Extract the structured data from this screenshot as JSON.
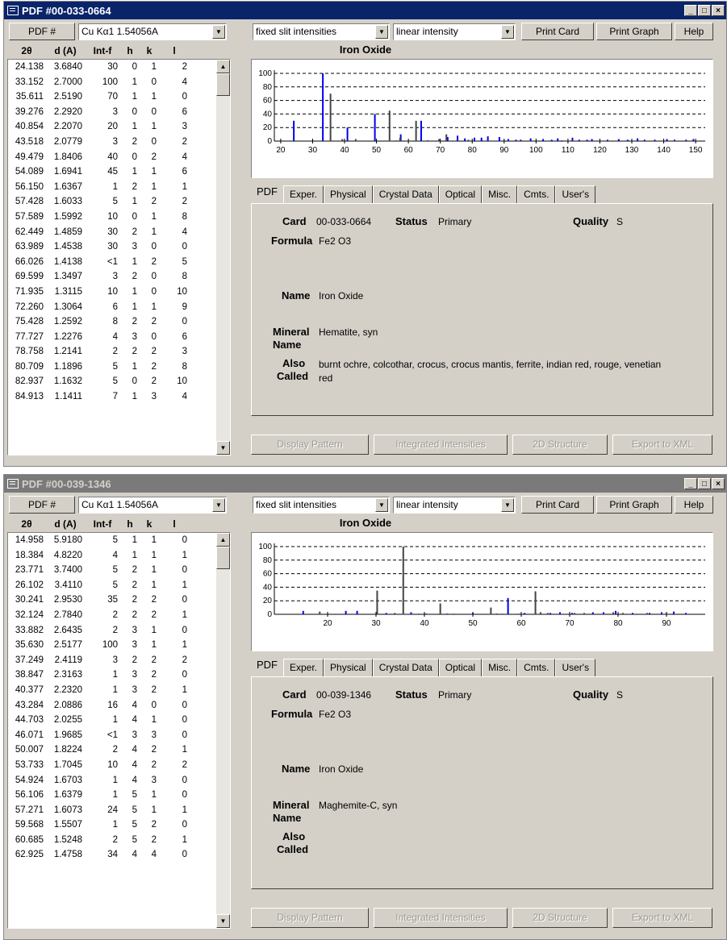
{
  "windows": [
    {
      "title": "PDF #00-033-0664",
      "active": true,
      "top_offset": 1,
      "pdf_button": "PDF #",
      "radiation": "Cu Kα1 1.54056A",
      "intensity_mode": "fixed slit intensities",
      "intensity_scale": "linear intensity",
      "print_card": "Print Card",
      "print_graph": "Print Graph",
      "help": "Help",
      "columns": [
        "2θ",
        "d (A)",
        "Int-f",
        "h",
        "k",
        "l"
      ],
      "rows": [
        [
          "24.138",
          "3.6840",
          "30",
          "0",
          "1",
          "2"
        ],
        [
          "33.152",
          "2.7000",
          "100",
          "1",
          "0",
          "4"
        ],
        [
          "35.611",
          "2.5190",
          "70",
          "1",
          "1",
          "0"
        ],
        [
          "39.276",
          "2.2920",
          "3",
          "0",
          "0",
          "6"
        ],
        [
          "40.854",
          "2.2070",
          "20",
          "1",
          "1",
          "3"
        ],
        [
          "43.518",
          "2.0779",
          "3",
          "2",
          "0",
          "2"
        ],
        [
          "49.479",
          "1.8406",
          "40",
          "0",
          "2",
          "4"
        ],
        [
          "54.089",
          "1.6941",
          "45",
          "1",
          "1",
          "6"
        ],
        [
          "56.150",
          "1.6367",
          "1",
          "2",
          "1",
          "1"
        ],
        [
          "57.428",
          "1.6033",
          "5",
          "1",
          "2",
          "2"
        ],
        [
          "57.589",
          "1.5992",
          "10",
          "0",
          "1",
          "8"
        ],
        [
          "62.449",
          "1.4859",
          "30",
          "2",
          "1",
          "4"
        ],
        [
          "63.989",
          "1.4538",
          "30",
          "3",
          "0",
          "0"
        ],
        [
          "66.026",
          "1.4138",
          "<1",
          "1",
          "2",
          "5"
        ],
        [
          "69.599",
          "1.3497",
          "3",
          "2",
          "0",
          "8"
        ],
        [
          "71.935",
          "1.3115",
          "10",
          "1",
          "0",
          "10"
        ],
        [
          "72.260",
          "1.3064",
          "6",
          "1",
          "1",
          "9"
        ],
        [
          "75.428",
          "1.2592",
          "8",
          "2",
          "2",
          "0"
        ],
        [
          "77.727",
          "1.2276",
          "4",
          "3",
          "0",
          "6"
        ],
        [
          "78.758",
          "1.2141",
          "2",
          "2",
          "2",
          "3"
        ],
        [
          "80.709",
          "1.1896",
          "5",
          "1",
          "2",
          "8"
        ],
        [
          "82.937",
          "1.1632",
          "5",
          "0",
          "2",
          "10"
        ],
        [
          "84.913",
          "1.1411",
          "7",
          "1",
          "3",
          "4"
        ]
      ],
      "chart_title": "Iron Oxide",
      "chart_data": {
        "type": "bar",
        "xlim": [
          18,
          153
        ],
        "ylim": [
          0,
          100
        ],
        "xticks": [
          20,
          30,
          40,
          50,
          60,
          70,
          80,
          90,
          100,
          110,
          120,
          130,
          140,
          150
        ],
        "yticks": [
          0,
          20,
          40,
          60,
          80,
          100
        ],
        "grid": "dashed horizontal",
        "series": [
          {
            "color": "#0000ee",
            "x": [
              24.1,
              33.2,
              40.9,
              49.5,
              57.6,
              64.0,
              66.0,
              72.3,
              75.4,
              77.7,
              80.7,
              82.9,
              84.9,
              88.5,
              91.3,
              93.7,
              95.2,
              98.3,
              102.2,
              104.9,
              106.8,
              108.1,
              111.4,
              113.5,
              116.0,
              117.5,
              122.4,
              125.9,
              128.7,
              131.8,
              134.0,
              137.2,
              141.0,
              143.4,
              147.0,
              149.3
            ],
            "y": [
              30,
              100,
              20,
              40,
              10,
              30,
              1,
              6,
              8,
              4,
              5,
              5,
              7,
              6,
              3,
              2,
              2,
              4,
              3,
              2,
              4,
              1,
              5,
              2,
              2,
              3,
              2,
              3,
              2,
              4,
              2,
              2,
              3,
              2,
              2,
              3
            ]
          },
          {
            "color": "#444444",
            "x": [
              35.6,
              39.3,
              43.5,
              54.1,
              56.2,
              57.4,
              62.4,
              69.6,
              71.9,
              78.8
            ],
            "y": [
              70,
              3,
              3,
              45,
              1,
              5,
              30,
              3,
              10,
              2
            ]
          }
        ]
      },
      "tabs": [
        "PDF",
        "Exper.",
        "Physical",
        "Crystal Data",
        "Optical",
        "Misc.",
        "Cmts.",
        "User's"
      ],
      "card_label": "Card",
      "card_value": "00-033-0664",
      "status_label": "Status",
      "status_value": "Primary",
      "quality_label": "Quality",
      "quality_value": "S",
      "formula_label": "Formula",
      "formula_value": "Fe2 O3",
      "name_label": "Name",
      "name_value": "Iron Oxide",
      "mineral_label": "Mineral",
      "mineral_label2": "Name",
      "mineral_value": "Hematite, syn",
      "also_label": "Also",
      "also_label2": "Called",
      "also_value": "burnt ochre, colcothar, crocus, crocus mantis, ferrite, indian red, rouge, venetian red",
      "bottom_buttons": [
        "Display Pattern",
        "Integrated Intensities",
        "2D Structure",
        "Export to XML"
      ]
    },
    {
      "title": "PDF #00-039-1346",
      "active": false,
      "top_offset": 588,
      "pdf_button": "PDF #",
      "radiation": "Cu Kα1 1.54056A",
      "intensity_mode": "fixed slit intensities",
      "intensity_scale": "linear intensity",
      "print_card": "Print Card",
      "print_graph": "Print Graph",
      "help": "Help",
      "columns": [
        "2θ",
        "d (A)",
        "Int-f",
        "h",
        "k",
        "l"
      ],
      "rows": [
        [
          "14.958",
          "5.9180",
          "5",
          "1",
          "1",
          "0"
        ],
        [
          "18.384",
          "4.8220",
          "4",
          "1",
          "1",
          "1"
        ],
        [
          "23.771",
          "3.7400",
          "5",
          "2",
          "1",
          "0"
        ],
        [
          "26.102",
          "3.4110",
          "5",
          "2",
          "1",
          "1"
        ],
        [
          "30.241",
          "2.9530",
          "35",
          "2",
          "2",
          "0"
        ],
        [
          "32.124",
          "2.7840",
          "2",
          "2",
          "2",
          "1"
        ],
        [
          "33.882",
          "2.6435",
          "2",
          "3",
          "1",
          "0"
        ],
        [
          "35.630",
          "2.5177",
          "100",
          "3",
          "1",
          "1"
        ],
        [
          "37.249",
          "2.4119",
          "3",
          "2",
          "2",
          "2"
        ],
        [
          "38.847",
          "2.3163",
          "1",
          "3",
          "2",
          "0"
        ],
        [
          "40.377",
          "2.2320",
          "1",
          "3",
          "2",
          "1"
        ],
        [
          "43.284",
          "2.0886",
          "16",
          "4",
          "0",
          "0"
        ],
        [
          "44.703",
          "2.0255",
          "1",
          "4",
          "1",
          "0"
        ],
        [
          "46.071",
          "1.9685",
          "<1",
          "3",
          "3",
          "0"
        ],
        [
          "50.007",
          "1.8224",
          "2",
          "4",
          "2",
          "1"
        ],
        [
          "53.733",
          "1.7045",
          "10",
          "4",
          "2",
          "2"
        ],
        [
          "54.924",
          "1.6703",
          "1",
          "4",
          "3",
          "0"
        ],
        [
          "56.106",
          "1.6379",
          "1",
          "5",
          "1",
          "0"
        ],
        [
          "57.271",
          "1.6073",
          "24",
          "5",
          "1",
          "1"
        ],
        [
          "59.568",
          "1.5507",
          "1",
          "5",
          "2",
          "0"
        ],
        [
          "60.685",
          "1.5248",
          "2",
          "5",
          "2",
          "1"
        ],
        [
          "62.925",
          "1.4758",
          "34",
          "4",
          "4",
          "0"
        ]
      ],
      "chart_title": "Iron Oxide",
      "chart_data": {
        "type": "bar",
        "xlim": [
          9,
          98
        ],
        "ylim": [
          0,
          100
        ],
        "xticks": [
          20,
          30,
          40,
          50,
          60,
          70,
          80,
          90
        ],
        "yticks": [
          0,
          20,
          40,
          60,
          80,
          100
        ],
        "grid": "dashed horizontal",
        "series": [
          {
            "color": "#0000ee",
            "x": [
              14.96,
              23.77,
              26.1,
              32.12,
              37.25,
              40.38,
              44.7,
              50.01,
              55.0,
              57.27,
              60.69,
              66.0,
              68.0,
              70.5,
              74.8,
              77.0,
              79.5,
              83.0,
              86.5,
              89.0,
              91.5,
              94.0
            ],
            "y": [
              5,
              5,
              5,
              2,
              3,
              1,
              1,
              2,
              1,
              24,
              2,
              2,
              3,
              2,
              3,
              3,
              5,
              2,
              2,
              3,
              4,
              2
            ]
          },
          {
            "color": "#444444",
            "x": [
              18.38,
              30.24,
              33.88,
              35.63,
              38.85,
              43.28,
              46.07,
              53.73,
              54.92,
              56.11,
              59.57,
              62.93,
              64.0,
              65.5,
              71.0,
              73.0,
              79.0,
              81.0,
              86.0,
              90.0
            ],
            "y": [
              4,
              35,
              2,
              100,
              1,
              16,
              1,
              10,
              1,
              1,
              1,
              34,
              3,
              2,
              2,
              2,
              3,
              2,
              2,
              2
            ]
          }
        ]
      },
      "tabs": [
        "PDF",
        "Exper.",
        "Physical",
        "Crystal Data",
        "Optical",
        "Misc.",
        "Cmts.",
        "User's"
      ],
      "card_label": "Card",
      "card_value": "00-039-1346",
      "status_label": "Status",
      "status_value": "Primary",
      "quality_label": "Quality",
      "quality_value": "S",
      "formula_label": "Formula",
      "formula_value": "Fe2 O3",
      "name_label": "Name",
      "name_value": "Iron Oxide",
      "mineral_label": "Mineral",
      "mineral_label2": "Name",
      "mineral_value": "Maghemite-C, syn",
      "also_label": "Also",
      "also_label2": "Called",
      "also_value": "",
      "bottom_buttons": [
        "Display Pattern",
        "Integrated Intensities",
        "2D Structure",
        "Export to XML"
      ]
    }
  ]
}
